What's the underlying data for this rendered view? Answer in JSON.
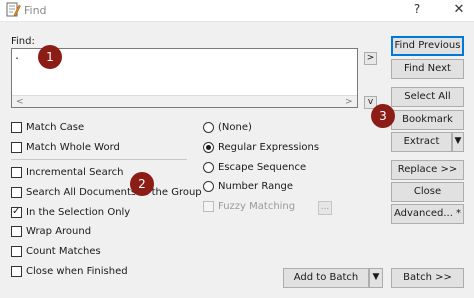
{
  "window": {
    "title": "Find",
    "help_label": "?",
    "close_label": "✕",
    "icon": "notepad-pencil-icon"
  },
  "find": {
    "label": "Find:",
    "value": "."
  },
  "scroll": {
    "left_glyph": "<",
    "right_glyph": ">"
  },
  "small_buttons": {
    "history_next": ">",
    "history_down": "v"
  },
  "options": [
    {
      "label": "Match Case",
      "checked": false
    },
    {
      "label": "Match Whole Word",
      "checked": false
    },
    {
      "label": "Incremental Search",
      "checked": false
    },
    {
      "label": "Search All Documents in the Group",
      "checked": false
    },
    {
      "label": "In the Selection Only",
      "checked": true
    },
    {
      "label": "Wrap Around",
      "checked": false
    },
    {
      "label": "Count Matches",
      "checked": false
    },
    {
      "label": "Close when Finished",
      "checked": false
    }
  ],
  "modes": [
    {
      "label": "(None)",
      "selected": false
    },
    {
      "label": "Regular Expressions",
      "selected": true
    },
    {
      "label": "Escape Sequence",
      "selected": false
    },
    {
      "label": "Number Range",
      "selected": false
    }
  ],
  "fuzzy": {
    "label": "Fuzzy Matching",
    "enabled": false,
    "ellipsis": "..."
  },
  "buttons": {
    "find_previous": "Find Previous",
    "find_next": "Find Next",
    "select_all": "Select All",
    "bookmark": "Bookmark",
    "extract": "Extract",
    "replace": "Replace >>",
    "close": "Close",
    "advanced": "Advanced... *",
    "add_to_batch": "Add to Batch",
    "batch": "Batch >>",
    "dropdown_glyph": "▼"
  },
  "badges": [
    "1",
    "2",
    "3"
  ]
}
